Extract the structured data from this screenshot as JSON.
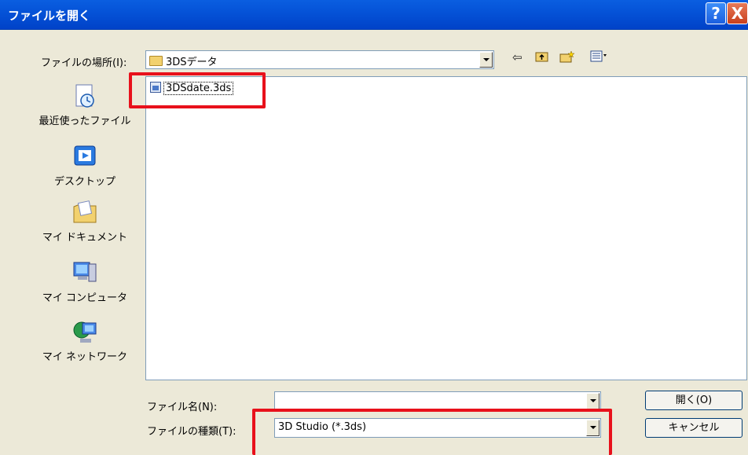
{
  "window": {
    "title": "ファイルを開く",
    "help_label": "?",
    "close_label": "X"
  },
  "lookin": {
    "label": "ファイルの場所(I):",
    "value": "3DSデータ"
  },
  "places": [
    {
      "label": "最近使ったファイル",
      "icon": "recent-documents-icon"
    },
    {
      "label": "デスクトップ",
      "icon": "desktop-icon"
    },
    {
      "label": "マイ ドキュメント",
      "icon": "my-documents-icon"
    },
    {
      "label": "マイ コンピュータ",
      "icon": "my-computer-icon"
    },
    {
      "label": "マイ ネットワーク",
      "icon": "my-network-icon"
    }
  ],
  "files": [
    {
      "name": "3DSdate.3ds",
      "icon": "3ds-file-icon"
    }
  ],
  "filename": {
    "label": "ファイル名(N):",
    "value": ""
  },
  "filetype": {
    "label": "ファイルの種類(T):",
    "value": "3D Studio (*.3ds)"
  },
  "buttons": {
    "open": "開く(O)",
    "cancel": "キャンセル"
  },
  "toolbar_icons": [
    "back-arrow-icon",
    "up-folder-icon",
    "new-folder-icon",
    "view-menu-icon"
  ],
  "colors": {
    "titlebar": "#0553d8",
    "highlight": "#e8111b",
    "dialog_bg": "#ece9d8"
  }
}
